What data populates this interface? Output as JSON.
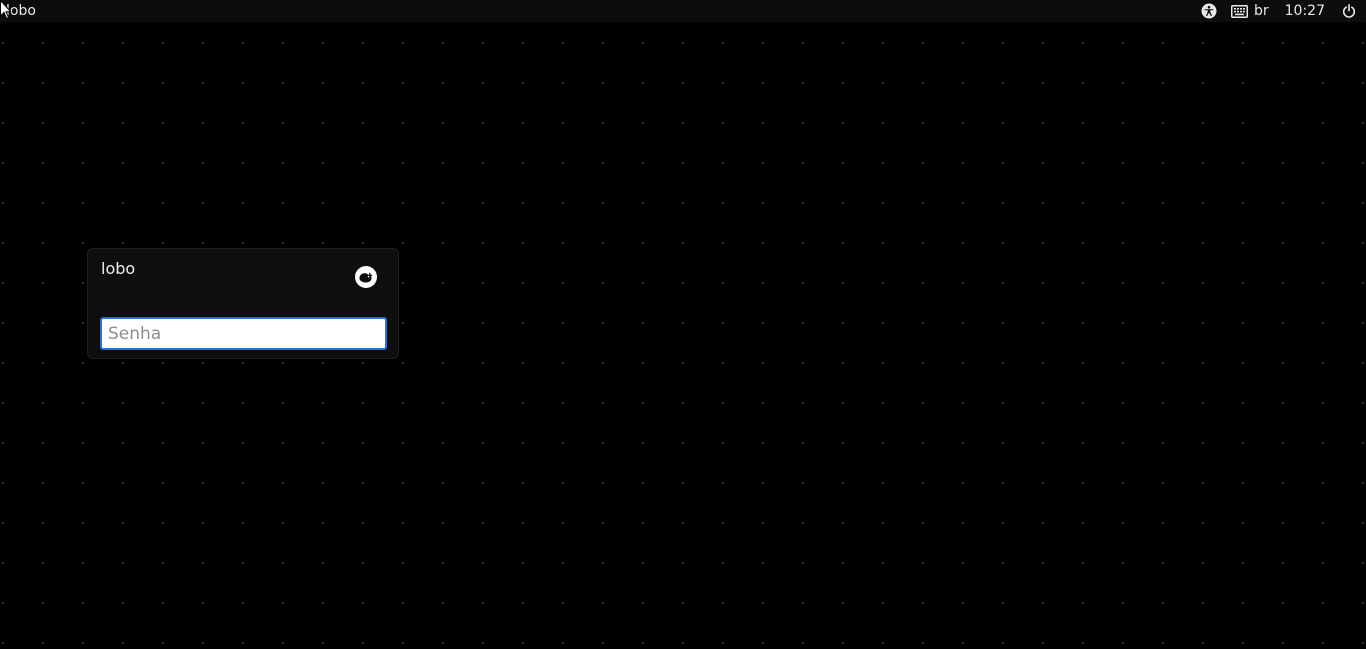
{
  "topbar": {
    "hostname": "lobo",
    "accessibility_icon": "accessibility-icon",
    "keyboard_icon": "keyboard-icon",
    "keyboard_layout": "br",
    "clock": "10:27",
    "power_icon": "power-icon"
  },
  "login": {
    "username": "lobo",
    "session_icon": "xfce-mouse-icon",
    "password": {
      "value": "",
      "placeholder": "Senha"
    }
  },
  "colors": {
    "background": "#000000",
    "topbar": "#0c0c0c",
    "panel": "#0e0e0e",
    "focus_accent": "#2a6fd6"
  }
}
